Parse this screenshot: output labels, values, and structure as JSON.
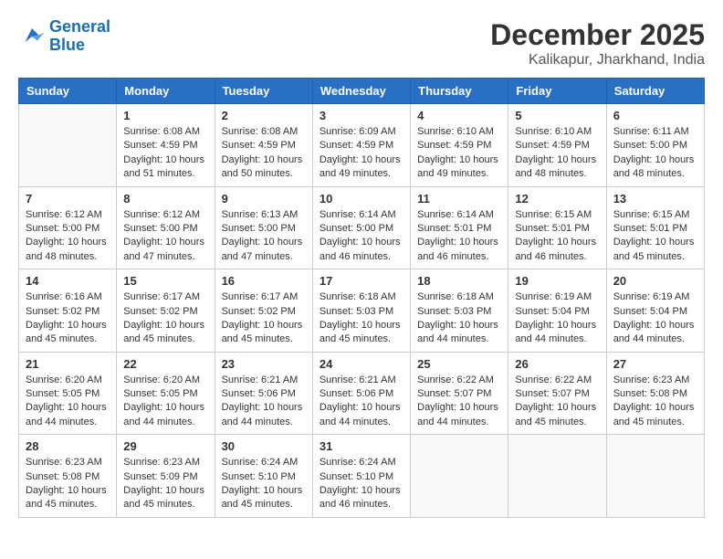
{
  "logo": {
    "line1": "General",
    "line2": "Blue"
  },
  "title": {
    "month_year": "December 2025",
    "location": "Kalikapur, Jharkhand, India"
  },
  "days_of_week": [
    "Sunday",
    "Monday",
    "Tuesday",
    "Wednesday",
    "Thursday",
    "Friday",
    "Saturday"
  ],
  "weeks": [
    [
      {
        "day": "",
        "sunrise": "",
        "sunset": "",
        "daylight": "",
        "empty": true
      },
      {
        "day": "1",
        "sunrise": "Sunrise: 6:08 AM",
        "sunset": "Sunset: 4:59 PM",
        "daylight": "Daylight: 10 hours and 51 minutes."
      },
      {
        "day": "2",
        "sunrise": "Sunrise: 6:08 AM",
        "sunset": "Sunset: 4:59 PM",
        "daylight": "Daylight: 10 hours and 50 minutes."
      },
      {
        "day": "3",
        "sunrise": "Sunrise: 6:09 AM",
        "sunset": "Sunset: 4:59 PM",
        "daylight": "Daylight: 10 hours and 49 minutes."
      },
      {
        "day": "4",
        "sunrise": "Sunrise: 6:10 AM",
        "sunset": "Sunset: 4:59 PM",
        "daylight": "Daylight: 10 hours and 49 minutes."
      },
      {
        "day": "5",
        "sunrise": "Sunrise: 6:10 AM",
        "sunset": "Sunset: 4:59 PM",
        "daylight": "Daylight: 10 hours and 48 minutes."
      },
      {
        "day": "6",
        "sunrise": "Sunrise: 6:11 AM",
        "sunset": "Sunset: 5:00 PM",
        "daylight": "Daylight: 10 hours and 48 minutes."
      }
    ],
    [
      {
        "day": "7",
        "sunrise": "Sunrise: 6:12 AM",
        "sunset": "Sunset: 5:00 PM",
        "daylight": "Daylight: 10 hours and 48 minutes."
      },
      {
        "day": "8",
        "sunrise": "Sunrise: 6:12 AM",
        "sunset": "Sunset: 5:00 PM",
        "daylight": "Daylight: 10 hours and 47 minutes."
      },
      {
        "day": "9",
        "sunrise": "Sunrise: 6:13 AM",
        "sunset": "Sunset: 5:00 PM",
        "daylight": "Daylight: 10 hours and 47 minutes."
      },
      {
        "day": "10",
        "sunrise": "Sunrise: 6:14 AM",
        "sunset": "Sunset: 5:00 PM",
        "daylight": "Daylight: 10 hours and 46 minutes."
      },
      {
        "day": "11",
        "sunrise": "Sunrise: 6:14 AM",
        "sunset": "Sunset: 5:01 PM",
        "daylight": "Daylight: 10 hours and 46 minutes."
      },
      {
        "day": "12",
        "sunrise": "Sunrise: 6:15 AM",
        "sunset": "Sunset: 5:01 PM",
        "daylight": "Daylight: 10 hours and 46 minutes."
      },
      {
        "day": "13",
        "sunrise": "Sunrise: 6:15 AM",
        "sunset": "Sunset: 5:01 PM",
        "daylight": "Daylight: 10 hours and 45 minutes."
      }
    ],
    [
      {
        "day": "14",
        "sunrise": "Sunrise: 6:16 AM",
        "sunset": "Sunset: 5:02 PM",
        "daylight": "Daylight: 10 hours and 45 minutes."
      },
      {
        "day": "15",
        "sunrise": "Sunrise: 6:17 AM",
        "sunset": "Sunset: 5:02 PM",
        "daylight": "Daylight: 10 hours and 45 minutes."
      },
      {
        "day": "16",
        "sunrise": "Sunrise: 6:17 AM",
        "sunset": "Sunset: 5:02 PM",
        "daylight": "Daylight: 10 hours and 45 minutes."
      },
      {
        "day": "17",
        "sunrise": "Sunrise: 6:18 AM",
        "sunset": "Sunset: 5:03 PM",
        "daylight": "Daylight: 10 hours and 45 minutes."
      },
      {
        "day": "18",
        "sunrise": "Sunrise: 6:18 AM",
        "sunset": "Sunset: 5:03 PM",
        "daylight": "Daylight: 10 hours and 44 minutes."
      },
      {
        "day": "19",
        "sunrise": "Sunrise: 6:19 AM",
        "sunset": "Sunset: 5:04 PM",
        "daylight": "Daylight: 10 hours and 44 minutes."
      },
      {
        "day": "20",
        "sunrise": "Sunrise: 6:19 AM",
        "sunset": "Sunset: 5:04 PM",
        "daylight": "Daylight: 10 hours and 44 minutes."
      }
    ],
    [
      {
        "day": "21",
        "sunrise": "Sunrise: 6:20 AM",
        "sunset": "Sunset: 5:05 PM",
        "daylight": "Daylight: 10 hours and 44 minutes."
      },
      {
        "day": "22",
        "sunrise": "Sunrise: 6:20 AM",
        "sunset": "Sunset: 5:05 PM",
        "daylight": "Daylight: 10 hours and 44 minutes."
      },
      {
        "day": "23",
        "sunrise": "Sunrise: 6:21 AM",
        "sunset": "Sunset: 5:06 PM",
        "daylight": "Daylight: 10 hours and 44 minutes."
      },
      {
        "day": "24",
        "sunrise": "Sunrise: 6:21 AM",
        "sunset": "Sunset: 5:06 PM",
        "daylight": "Daylight: 10 hours and 44 minutes."
      },
      {
        "day": "25",
        "sunrise": "Sunrise: 6:22 AM",
        "sunset": "Sunset: 5:07 PM",
        "daylight": "Daylight: 10 hours and 44 minutes."
      },
      {
        "day": "26",
        "sunrise": "Sunrise: 6:22 AM",
        "sunset": "Sunset: 5:07 PM",
        "daylight": "Daylight: 10 hours and 45 minutes."
      },
      {
        "day": "27",
        "sunrise": "Sunrise: 6:23 AM",
        "sunset": "Sunset: 5:08 PM",
        "daylight": "Daylight: 10 hours and 45 minutes."
      }
    ],
    [
      {
        "day": "28",
        "sunrise": "Sunrise: 6:23 AM",
        "sunset": "Sunset: 5:08 PM",
        "daylight": "Daylight: 10 hours and 45 minutes."
      },
      {
        "day": "29",
        "sunrise": "Sunrise: 6:23 AM",
        "sunset": "Sunset: 5:09 PM",
        "daylight": "Daylight: 10 hours and 45 minutes."
      },
      {
        "day": "30",
        "sunrise": "Sunrise: 6:24 AM",
        "sunset": "Sunset: 5:10 PM",
        "daylight": "Daylight: 10 hours and 45 minutes."
      },
      {
        "day": "31",
        "sunrise": "Sunrise: 6:24 AM",
        "sunset": "Sunset: 5:10 PM",
        "daylight": "Daylight: 10 hours and 46 minutes."
      },
      {
        "day": "",
        "sunrise": "",
        "sunset": "",
        "daylight": "",
        "empty": true
      },
      {
        "day": "",
        "sunrise": "",
        "sunset": "",
        "daylight": "",
        "empty": true
      },
      {
        "day": "",
        "sunrise": "",
        "sunset": "",
        "daylight": "",
        "empty": true
      }
    ]
  ]
}
